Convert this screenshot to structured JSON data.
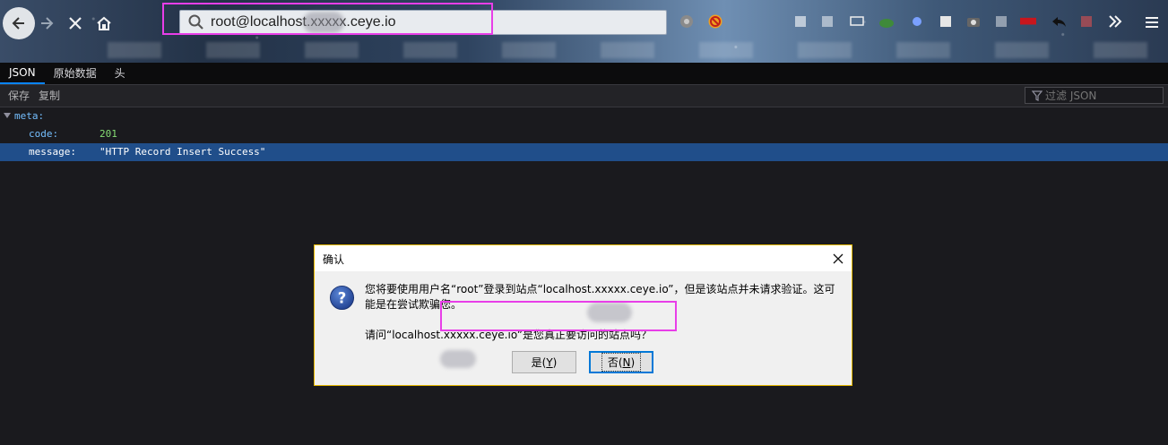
{
  "urlbar": {
    "value": "root@localhost.xxxxx.ceye.io"
  },
  "tabs": [
    {
      "label": "JSON",
      "active": true
    },
    {
      "label": "原始数据",
      "active": false
    },
    {
      "label": "头",
      "active": false
    }
  ],
  "actions": {
    "save": "保存",
    "copy": "复制",
    "filter_placeholder": "过滤 JSON"
  },
  "json": {
    "meta_key": "meta:",
    "code_key": "code:",
    "code_val": "201",
    "message_key": "message:",
    "message_val": "\"HTTP Record Insert Success\""
  },
  "dialog": {
    "title": "确认",
    "message_line1": "您将要使用用户名“root”登录到站点“localhost.xxxxx.ceye.io”，但是该站点并未请求验证。这可能是在尝试欺骗您。",
    "message_line2": "请问“localhost.xxxxx.ceye.io”是您真正要访问的站点吗？",
    "yes_text": "是(",
    "yes_key": "Y",
    "yes_end": ")",
    "no_text": "否(",
    "no_key": "N",
    "no_end": ")"
  },
  "colors": {
    "accent": "#0a84ff",
    "highlight_box": "#e83ee8",
    "selected_row": "#204e8a",
    "json_key": "#75bfff",
    "json_number": "#86de74"
  }
}
